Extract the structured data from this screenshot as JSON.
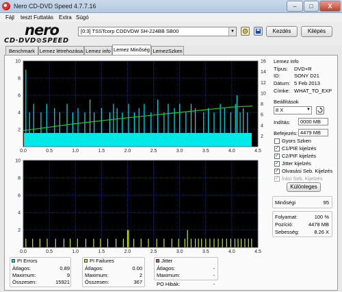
{
  "window": {
    "title": "Nero CD-DVD Speed 4.7.7.16",
    "minimize": "–",
    "maximize": "□",
    "close": "X"
  },
  "menu": [
    "Fájl",
    "teszt Futtatás",
    "Extra",
    "Súgó"
  ],
  "logo": {
    "main": "nero",
    "sub": "CD·DVD⊘SPEED"
  },
  "toolbar": {
    "drive": "[0:3]   TSSTcorp CDDVDW SH-224BB SB00",
    "start_label": "Kezdés",
    "exit_label": "Kilépés"
  },
  "tabs": [
    "Benchmark",
    "Lemez létrehozása",
    "Lemez info",
    "Lemez Minőség",
    "LemezSzken"
  ],
  "disc_info": {
    "title": "Lemez info",
    "rows": [
      {
        "label": "Típus:",
        "value": "DVD+R"
      },
      {
        "label": "ID:",
        "value": "SONY D21"
      },
      {
        "label": "Dátum:",
        "value": "5 Feb 2013"
      },
      {
        "label": "Címke:",
        "value": "WHAT_TO_EXP"
      }
    ]
  },
  "settings": {
    "title": "Beállítások",
    "speed": "8 X",
    "start_label": "Indítás:",
    "start_value": "0000 MB",
    "end_label": "Befejezés:",
    "end_value": "4479 MB",
    "checkboxes": [
      {
        "label": "Gyors Szken",
        "checked": false,
        "disabled": false
      },
      {
        "label": "C1/PIE kijelzés",
        "checked": true,
        "disabled": false
      },
      {
        "label": "C2/PIF kijelzés",
        "checked": true,
        "disabled": false
      },
      {
        "label": "Jitter kijelzés",
        "checked": true,
        "disabled": false
      },
      {
        "label": "Olvasási Seb. Kijelzés",
        "checked": true,
        "disabled": false
      },
      {
        "label": "Írási Seb. Kijelzés",
        "checked": true,
        "disabled": true
      }
    ],
    "advanced_label": "Különleges"
  },
  "quality": {
    "label": "Minőségi",
    "value": "95"
  },
  "progress": {
    "rows": [
      {
        "label": "Folyamat:",
        "value": "100 %"
      },
      {
        "label": "Pozíció:",
        "value": "4478 MB"
      },
      {
        "label": "Sebesség:",
        "value": "8.26 X"
      }
    ]
  },
  "stats": {
    "pi_errors": {
      "title": "PI Errors",
      "color": "#00e8e8",
      "rows": [
        {
          "label": "Átlagos:",
          "value": "0.89"
        },
        {
          "label": "Maximum:",
          "value": "9"
        },
        {
          "label": "Összesen:",
          "value": "15921"
        }
      ]
    },
    "pi_failures": {
      "title": "PI Failures",
      "color": "#ccee44",
      "rows": [
        {
          "label": "Átlagos:",
          "value": "0.00"
        },
        {
          "label": "Maximum:",
          "value": "2"
        },
        {
          "label": "Összesen:",
          "value": "367"
        }
      ]
    },
    "jitter": {
      "title": "Jitter",
      "color": "#dd44dd",
      "rows": [
        {
          "label": "Átlagos:",
          "value": "-"
        },
        {
          "label": "Maximum:",
          "value": "-"
        }
      ]
    },
    "po_label": "PO Hibák:",
    "po_value": "-"
  },
  "chart_data": [
    {
      "type": "bar",
      "colors": {
        "background": "#000000",
        "grid": "#1f3a8a",
        "bars": "#00e8e8",
        "speed": "#22cc22"
      },
      "xlim": [
        0,
        4.5
      ],
      "ylim": [
        0,
        10
      ],
      "y2lim": [
        0,
        16
      ],
      "x_ticks": [
        "0.0",
        "0.5",
        "1.0",
        "1.5",
        "2.0",
        "2.5",
        "3.0",
        "3.5",
        "4.0",
        "4.5"
      ],
      "y_ticks": [
        "2",
        "4",
        "6",
        "8",
        "10"
      ],
      "y2_ticks": [
        "2",
        "4",
        "6",
        "8",
        "10",
        "12",
        "14",
        "16"
      ],
      "baseline": 1.6,
      "spikes": [
        [
          0.05,
          9
        ],
        [
          0.12,
          4
        ],
        [
          0.2,
          5
        ],
        [
          0.34,
          4
        ],
        [
          0.45,
          5
        ],
        [
          0.6,
          4.5
        ],
        [
          0.7,
          4
        ],
        [
          0.84,
          5
        ],
        [
          0.95,
          4
        ],
        [
          1.05,
          4.5
        ],
        [
          1.18,
          4
        ],
        [
          1.28,
          5.5
        ],
        [
          1.36,
          4
        ],
        [
          1.5,
          4.5
        ],
        [
          1.66,
          4
        ],
        [
          1.73,
          5
        ],
        [
          1.8,
          4.5
        ],
        [
          1.9,
          4
        ],
        [
          2.02,
          5
        ],
        [
          2.13,
          4
        ],
        [
          2.22,
          4.5
        ],
        [
          2.32,
          5
        ],
        [
          2.45,
          4
        ],
        [
          2.58,
          5.5
        ],
        [
          2.7,
          4
        ],
        [
          2.78,
          5
        ],
        [
          2.9,
          4.5
        ],
        [
          3.0,
          5
        ],
        [
          3.12,
          4
        ],
        [
          3.22,
          5
        ],
        [
          3.3,
          4.5
        ],
        [
          3.46,
          4
        ],
        [
          3.55,
          4.5
        ],
        [
          3.66,
          4
        ],
        [
          3.78,
          5
        ],
        [
          3.86,
          4.5
        ],
        [
          3.98,
          4
        ],
        [
          4.07,
          5
        ],
        [
          4.1,
          6
        ],
        [
          4.16,
          4
        ],
        [
          4.22,
          4.5
        ],
        [
          4.3,
          4
        ]
      ],
      "speed": [
        [
          0.0,
          3.0
        ],
        [
          1.0,
          4.3
        ],
        [
          2.0,
          5.4
        ],
        [
          3.0,
          6.4
        ],
        [
          4.0,
          7.4
        ],
        [
          4.4,
          7.6
        ]
      ]
    },
    {
      "type": "bar",
      "colors": {
        "background": "#000000",
        "grid": "#1f3a8a",
        "bars": "#ccee44"
      },
      "xlim": [
        0,
        4.5
      ],
      "ylim": [
        0,
        10
      ],
      "x_ticks": [
        "0.0",
        "0.5",
        "1.0",
        "1.5",
        "2.0",
        "2.5",
        "3.0",
        "3.5",
        "4.0",
        "4.5"
      ],
      "y_ticks": [
        "2",
        "4",
        "6",
        "8",
        "10"
      ],
      "spikes": [
        [
          0.05,
          1
        ],
        [
          0.18,
          1
        ],
        [
          0.32,
          1
        ],
        [
          0.46,
          1
        ],
        [
          0.62,
          1
        ],
        [
          0.78,
          1
        ],
        [
          0.9,
          1
        ],
        [
          1.04,
          1
        ],
        [
          1.2,
          1
        ],
        [
          1.35,
          1
        ],
        [
          1.48,
          1
        ],
        [
          1.62,
          1
        ],
        [
          1.78,
          1
        ],
        [
          1.92,
          1
        ],
        [
          2.0,
          2
        ],
        [
          2.02,
          2
        ],
        [
          2.12,
          1
        ],
        [
          2.26,
          1
        ],
        [
          2.4,
          1
        ],
        [
          2.56,
          1
        ],
        [
          2.7,
          1
        ],
        [
          2.85,
          1
        ],
        [
          2.98,
          1
        ],
        [
          3.1,
          1
        ],
        [
          3.15,
          2
        ],
        [
          3.22,
          1
        ],
        [
          3.3,
          1
        ],
        [
          3.36,
          1
        ],
        [
          3.42,
          1
        ],
        [
          3.5,
          1
        ],
        [
          3.58,
          1
        ],
        [
          3.66,
          1
        ],
        [
          3.74,
          1
        ],
        [
          3.82,
          1
        ],
        [
          3.9,
          1
        ],
        [
          3.98,
          1
        ],
        [
          4.06,
          1
        ],
        [
          4.12,
          1
        ],
        [
          4.18,
          1
        ],
        [
          4.25,
          1
        ],
        [
          4.32,
          1
        ],
        [
          4.38,
          1
        ]
      ]
    }
  ]
}
